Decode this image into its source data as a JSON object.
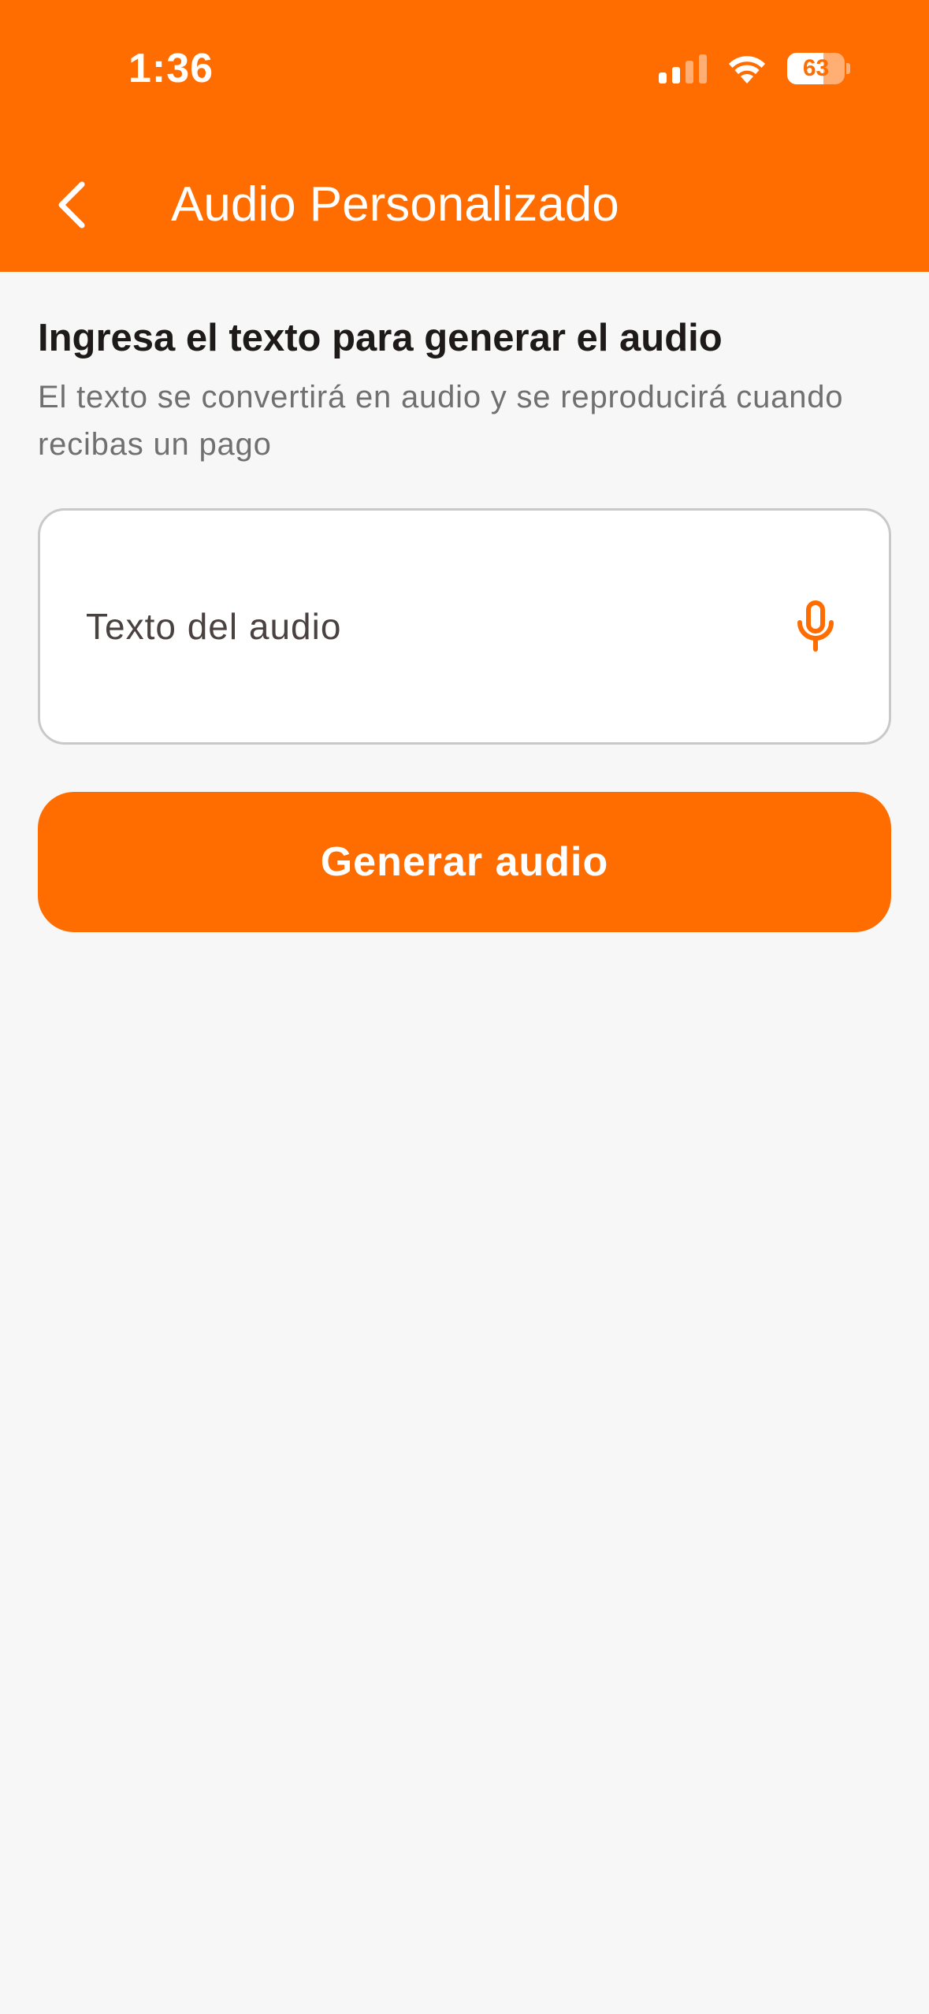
{
  "status_bar": {
    "time": "1:36",
    "battery_level": "63",
    "battery_fraction": 0.63,
    "signal_bars_active": 2,
    "signal_bars_total": 4
  },
  "nav_bar": {
    "back_icon": "chevron-left-icon",
    "title": "Audio Personalizado"
  },
  "content": {
    "title": "Ingresa el texto para generar el audio",
    "subtitle": "El texto se convertirá en audio y se reproducirá cuando recibas un pago",
    "audio_text_field": {
      "placeholder": "Texto del audio",
      "value": "",
      "trailing_icon": "microphone-icon"
    },
    "generate_button_label": "Generar audio"
  },
  "colors": {
    "accent": "#ff6d00",
    "background": "#f7f7f7",
    "title_text": "#1f1a1a",
    "subtitle_text": "#707070",
    "field_border": "#c9c9c9"
  }
}
